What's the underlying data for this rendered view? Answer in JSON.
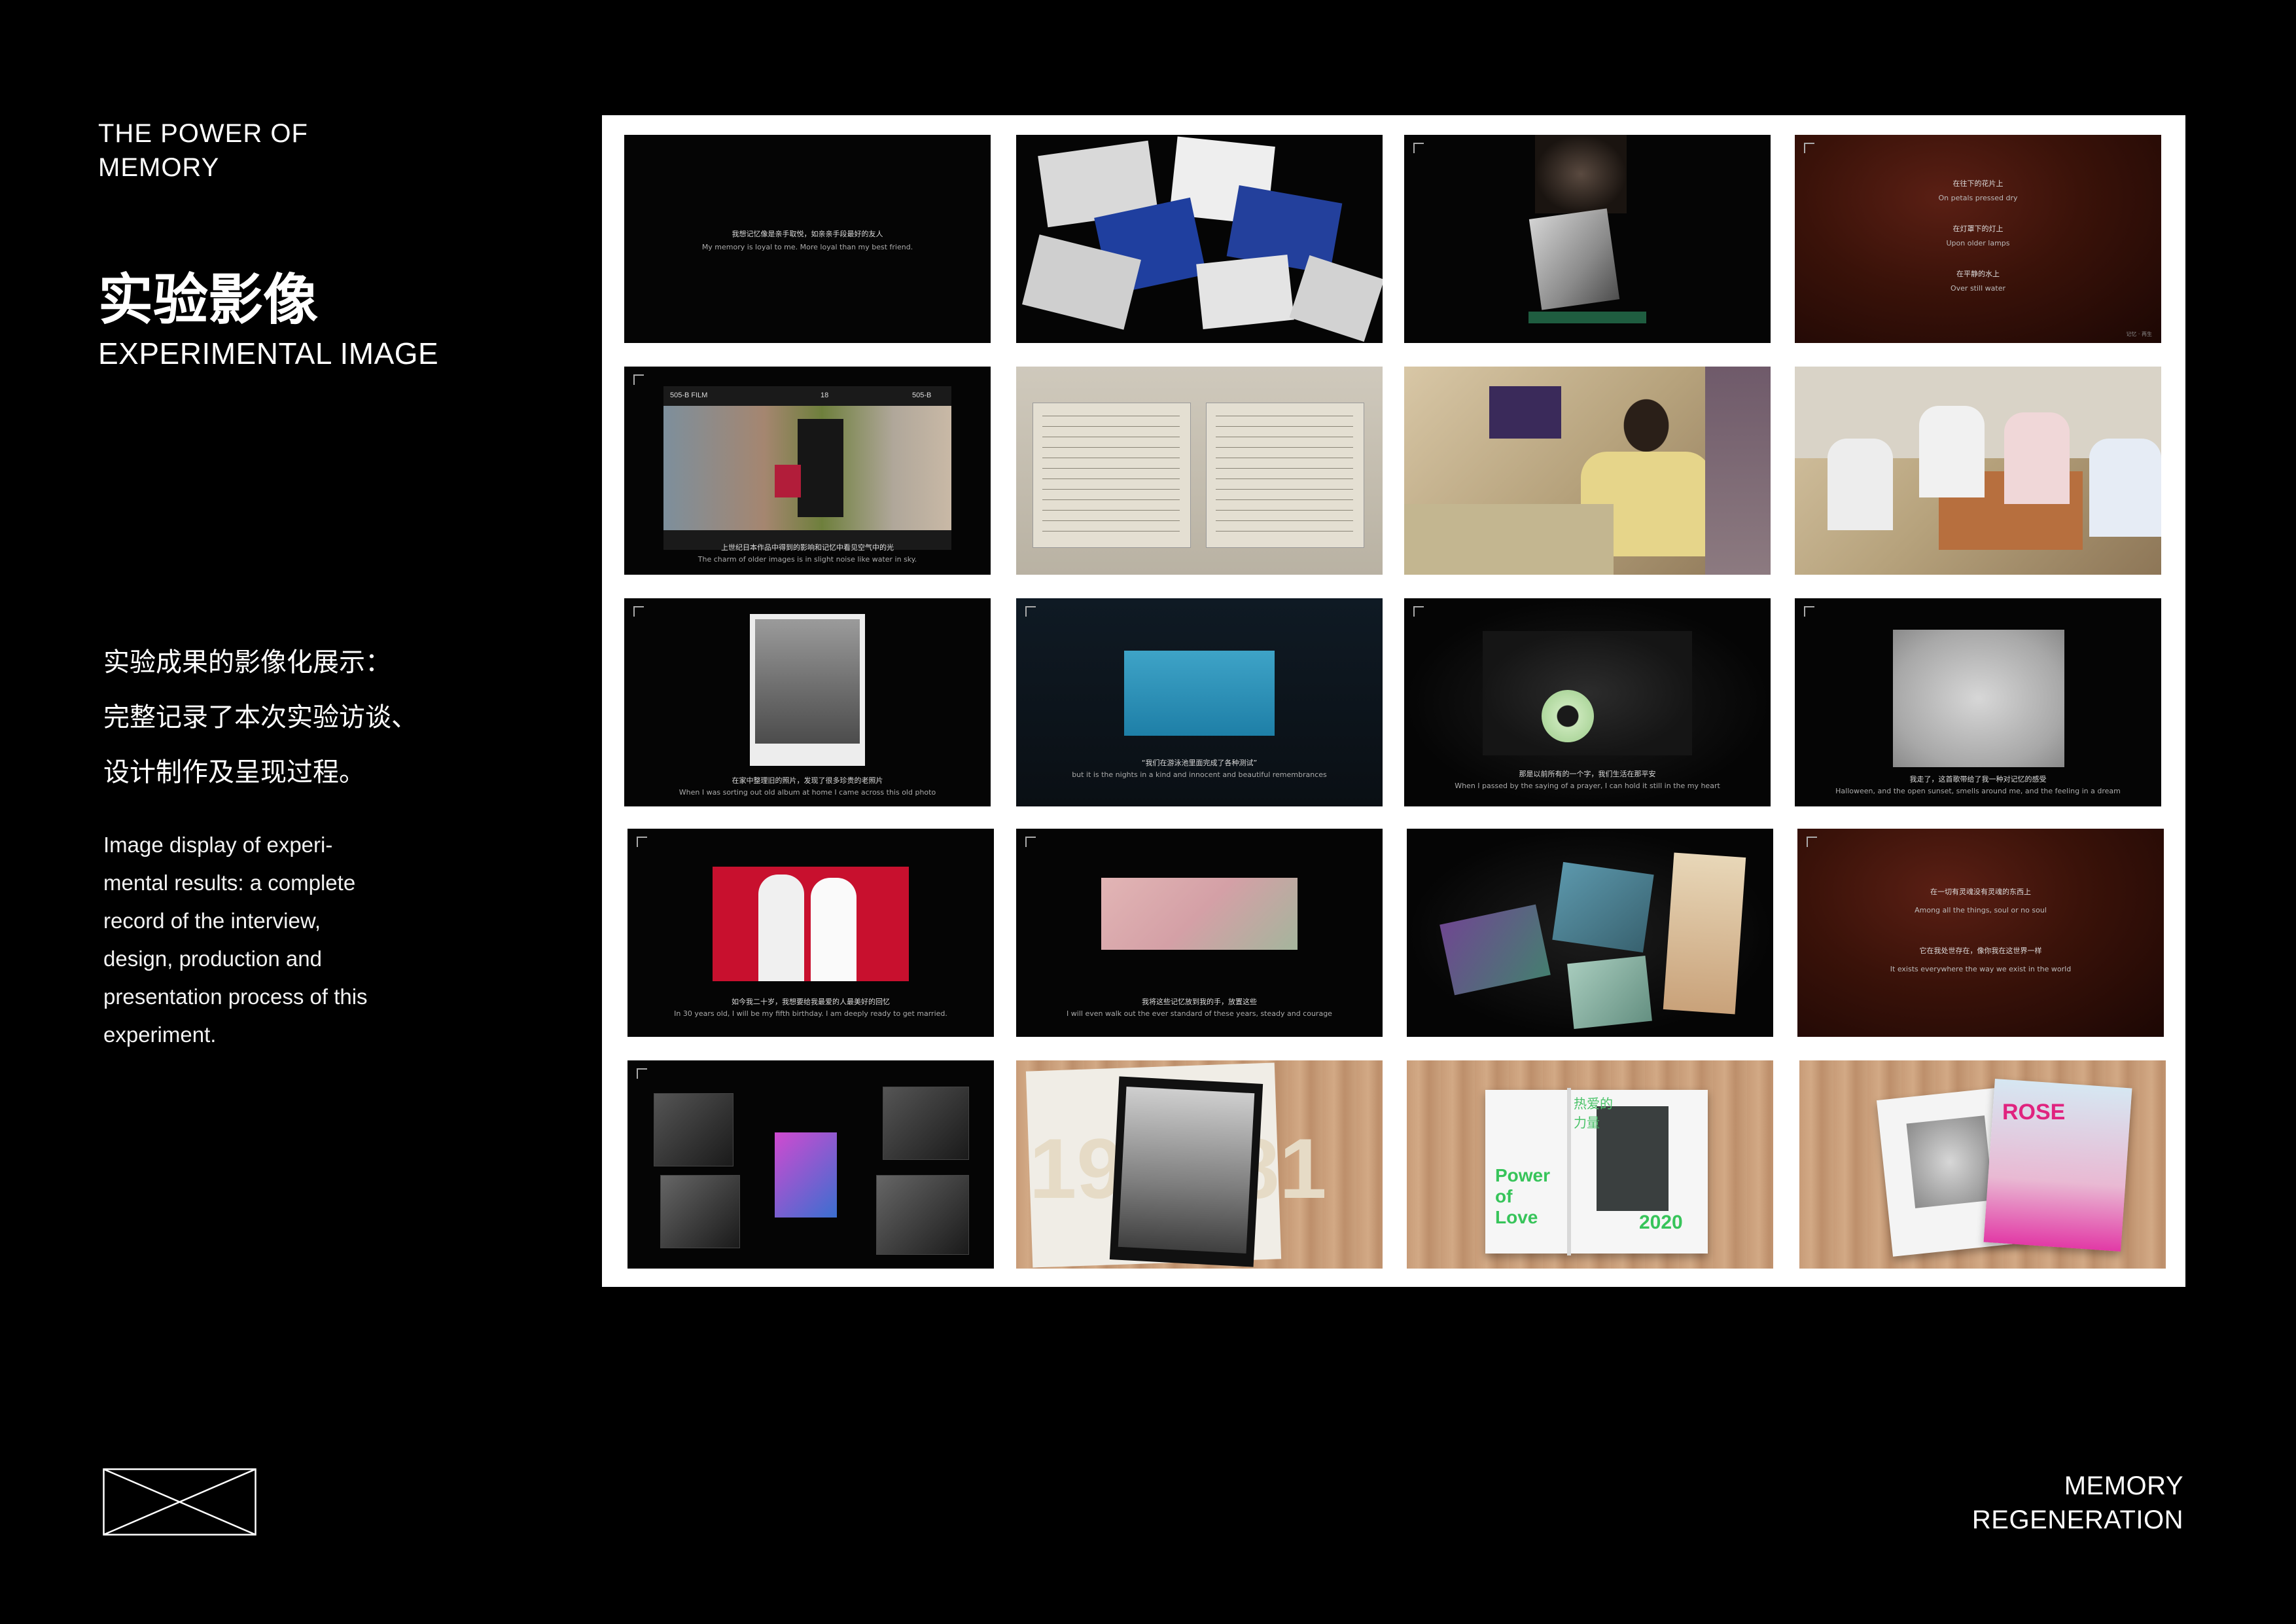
{
  "header": {
    "line1": "THE POWER OF",
    "line2": "MEMORY"
  },
  "section": {
    "title_cn": "实验影像",
    "title_en": "EXPERIMENTAL IMAGE"
  },
  "description_cn": [
    "实验成果的影像化展示：",
    "完整记录了本次实验访谈、",
    "设计制作及呈现过程。"
  ],
  "description_en": [
    "Image display of experi-",
    "mental results: a complete",
    "record of the interview,",
    "design, production and",
    "presentation process of this",
    "experiment."
  ],
  "footer": {
    "line1": "MEMORY",
    "line2": "REGENERATION"
  },
  "frames": {
    "f1": {
      "cn": "我想记忆像是亲手取悦，如亲亲手段最好的友人",
      "en": "My memory is loyal to me. More loyal than my best friend."
    },
    "f4": {
      "l1": "在往下的花片上",
      "l2": "On petals pressed dry",
      "l3": "在灯罩下的灯上",
      "l4": "Upon older lamps",
      "l5": "在平静的水上",
      "l6": "Over still water"
    },
    "f5": {
      "cn": "上世纪日本作品中得到的影响和记忆中看见空气中的光",
      "en": "The charm of older images is in slight noise like water in sky."
    },
    "f9": {
      "cn": "在家中整理旧的照片，发现了很多珍贵的老照片",
      "en": "When I was sorting out old album at home I came across this old photo"
    },
    "f10": {
      "cn": "“我们在游泳池里面完成了各种测试”",
      "en": "but it is the nights in a kind and innocent and beautiful remembrances"
    },
    "f11": {
      "cn": "那是以前所有的一个字，我们生活在那平安",
      "en": "When I passed by the saying of a prayer, I can hold it still in the my heart"
    },
    "f12": {
      "cn": "我走了，这首歌带给了我一种对记忆的感受",
      "en": "Halloween, and the open sunset, smells around me, and the feeling in a dream"
    },
    "f13": {
      "cn": "如今我二十岁，我想要给我最爱的人最美好的回忆",
      "en": "In 30 years old, I will be my fifth birthday. I am deeply ready to get married."
    },
    "f14": {
      "cn": "我将这些记忆放到我的手，放置这些",
      "en": "I will even walk out the ever standard of these years, steady and courage"
    },
    "f16": {
      "l1": "在一切有灵魂没有灵魂的东西上",
      "l2": "Among all the things, soul or no soul",
      "l3": "它在我处世存在，像你我在这世界一样",
      "l4": "It exists everywhere the way we exist in the world"
    },
    "f18": {
      "year_left": "19",
      "year_right": "81"
    },
    "f19": {
      "cn": "热爱的力量",
      "en1": "Power",
      "en2": "of",
      "en3": "Love",
      "year": "2020"
    },
    "f20": {
      "brand": "ROSE"
    },
    "film_label": "505-B FILM",
    "film_num": "18",
    "film_end": "505-B",
    "mark": "记忆 · 再生"
  }
}
